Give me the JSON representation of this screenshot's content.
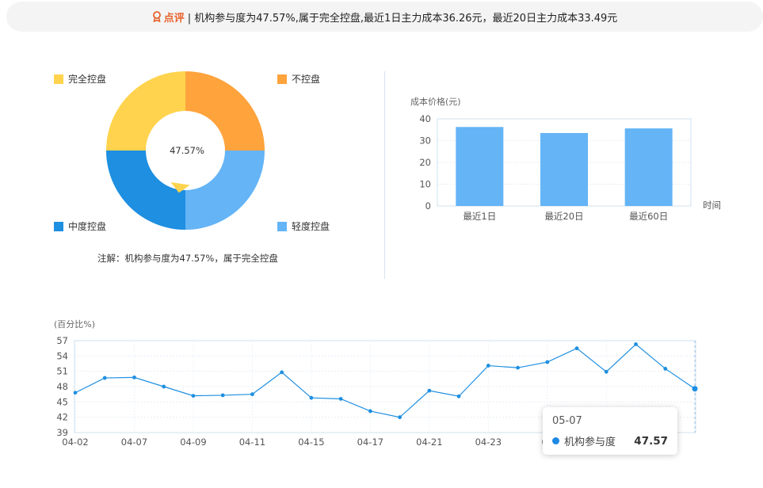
{
  "banner": {
    "label": "点评",
    "text": "| 机构参与度为47.57%,属于完全控盘,最近1日主力成本36.26元，最近20日主力成本33.49元"
  },
  "colors": {
    "complete": "#ffd34d",
    "none": "#ffa33d",
    "medium": "#1e8fe1",
    "light": "#64b4f6",
    "bar": "#64b4f6",
    "line": "#1e8fe1",
    "accent": "#e8622c"
  },
  "chart_data": [
    {
      "type": "pie",
      "center_label": "47.57%",
      "slices": [
        {
          "name": "不控盘",
          "value": 25,
          "color": "#ffa33d"
        },
        {
          "name": "轻度控盘",
          "value": 25,
          "color": "#64b4f6"
        },
        {
          "name": "中度控盘",
          "value": 25,
          "color": "#1e8fe1"
        },
        {
          "name": "完全控盘",
          "value": 25,
          "color": "#ffd34d"
        }
      ],
      "pointer_value": 47.57,
      "note": "注解：机构参与度为47.57%，属于完全控盘"
    },
    {
      "type": "bar",
      "ylabel": "成本价格(元)",
      "xlabel": "时间",
      "categories": [
        "最近1日",
        "最近20日",
        "最近60日"
      ],
      "values": [
        36.26,
        33.49,
        35.6
      ],
      "ylim": [
        0,
        40
      ],
      "yticks": [
        0,
        10,
        20,
        30,
        40
      ]
    },
    {
      "type": "line",
      "ylabel": "(百分比%)",
      "series": [
        {
          "name": "机构参与度",
          "values": [
            46.8,
            49.7,
            49.8,
            48.0,
            46.2,
            46.3,
            46.5,
            50.8,
            45.8,
            45.6,
            43.2,
            42.0,
            47.2,
            46.1,
            52.1,
            51.7,
            52.8,
            55.5,
            50.9,
            56.3,
            51.5,
            47.57
          ]
        }
      ],
      "xticks": [
        "04-02",
        "04-07",
        "04-09",
        "04-11",
        "04-15",
        "04-17",
        "04-21",
        "04-23",
        "04",
        "5"
      ],
      "ylim": [
        39,
        57
      ],
      "yticks": [
        39,
        42,
        45,
        48,
        51,
        54,
        57
      ],
      "tooltip": {
        "date": "05-07",
        "series": "机构参与度",
        "value": "47.57"
      }
    }
  ]
}
